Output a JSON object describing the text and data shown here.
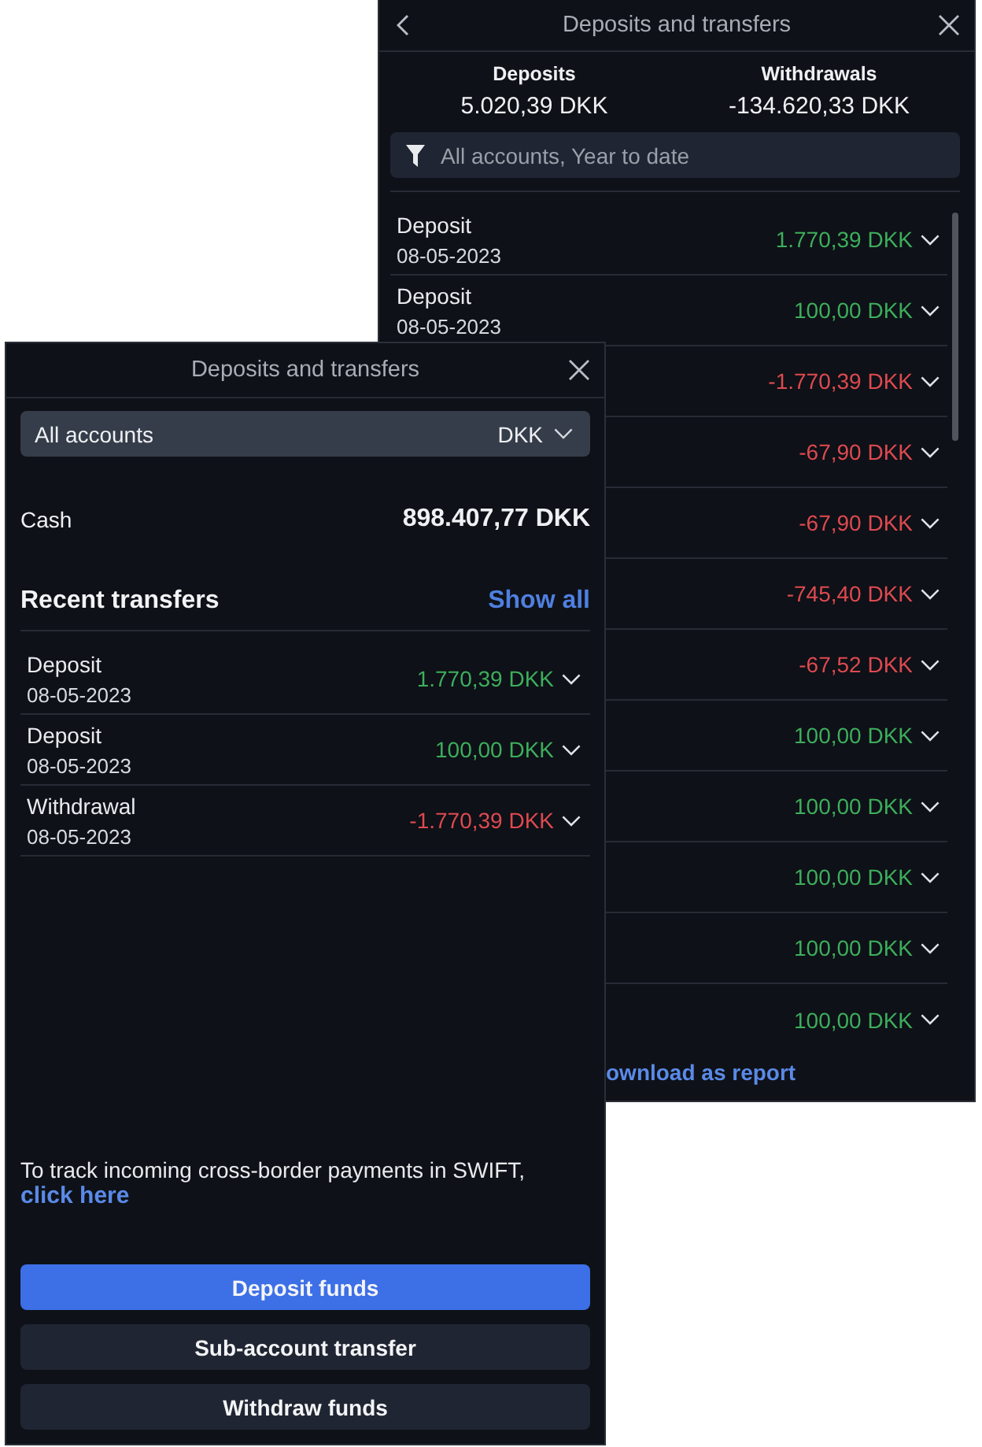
{
  "back_panel": {
    "title": "Deposits and transfers",
    "summary": [
      {
        "label": "Deposits",
        "value": "5.020,39 DKK"
      },
      {
        "label": "Withdrawals",
        "value": "-134.620,33 DKK"
      }
    ],
    "filter": {
      "label": "All accounts, Year to date"
    },
    "transfers": [
      {
        "type": "Deposit",
        "date": "08-05-2023",
        "amount": "1.770,39 DKK",
        "color": "#3dae5c"
      },
      {
        "type": "Deposit",
        "date": "08-05-2023",
        "amount": "100,00 DKK",
        "color": "#3dae5c"
      },
      {
        "amount": "-1.770,39 DKK",
        "color": "#de4a50"
      },
      {
        "amount": "-67,90 DKK",
        "color": "#de4a50"
      },
      {
        "amount": "-67,90 DKK",
        "color": "#de4a50"
      },
      {
        "amount": "-745,40 DKK",
        "color": "#de4a50"
      },
      {
        "amount": "-67,52 DKK",
        "color": "#de4a50"
      },
      {
        "amount": "100,00 DKK",
        "color": "#3dae5c"
      },
      {
        "amount": "100,00 DKK",
        "color": "#3dae5c"
      },
      {
        "amount": "100,00 DKK",
        "color": "#3dae5c"
      },
      {
        "amount": "100,00 DKK",
        "color": "#3dae5c"
      },
      {
        "amount": "100,00 DKK",
        "color": "#3dae5c"
      }
    ],
    "report_link": "ownload as report"
  },
  "front_panel": {
    "title": "Deposits and transfers",
    "account_selector": {
      "account": "All accounts",
      "currency": "DKK"
    },
    "cash": {
      "label": "Cash",
      "value": "898.407,77 DKK"
    },
    "recent": {
      "title": "Recent transfers",
      "show_all": "Show all",
      "transfers": [
        {
          "type": "Deposit",
          "date": "08-05-2023",
          "amount": "1.770,39 DKK",
          "color": "#3dae5c"
        },
        {
          "type": "Deposit",
          "date": "08-05-2023",
          "amount": "100,00 DKK",
          "color": "#3dae5c"
        },
        {
          "type": "Withdrawal",
          "date": "08-05-2023",
          "amount": "-1.770,39 DKK",
          "color": "#de4a50"
        }
      ]
    },
    "swift_note": {
      "text": "To track incoming cross-border payments in SWIFT,",
      "link": "click here"
    },
    "buttons": [
      {
        "label": "Deposit funds",
        "kind": "primary"
      },
      {
        "label": "Sub-account transfer",
        "kind": "secondary"
      },
      {
        "label": "Withdraw funds",
        "kind": "secondary"
      }
    ]
  }
}
